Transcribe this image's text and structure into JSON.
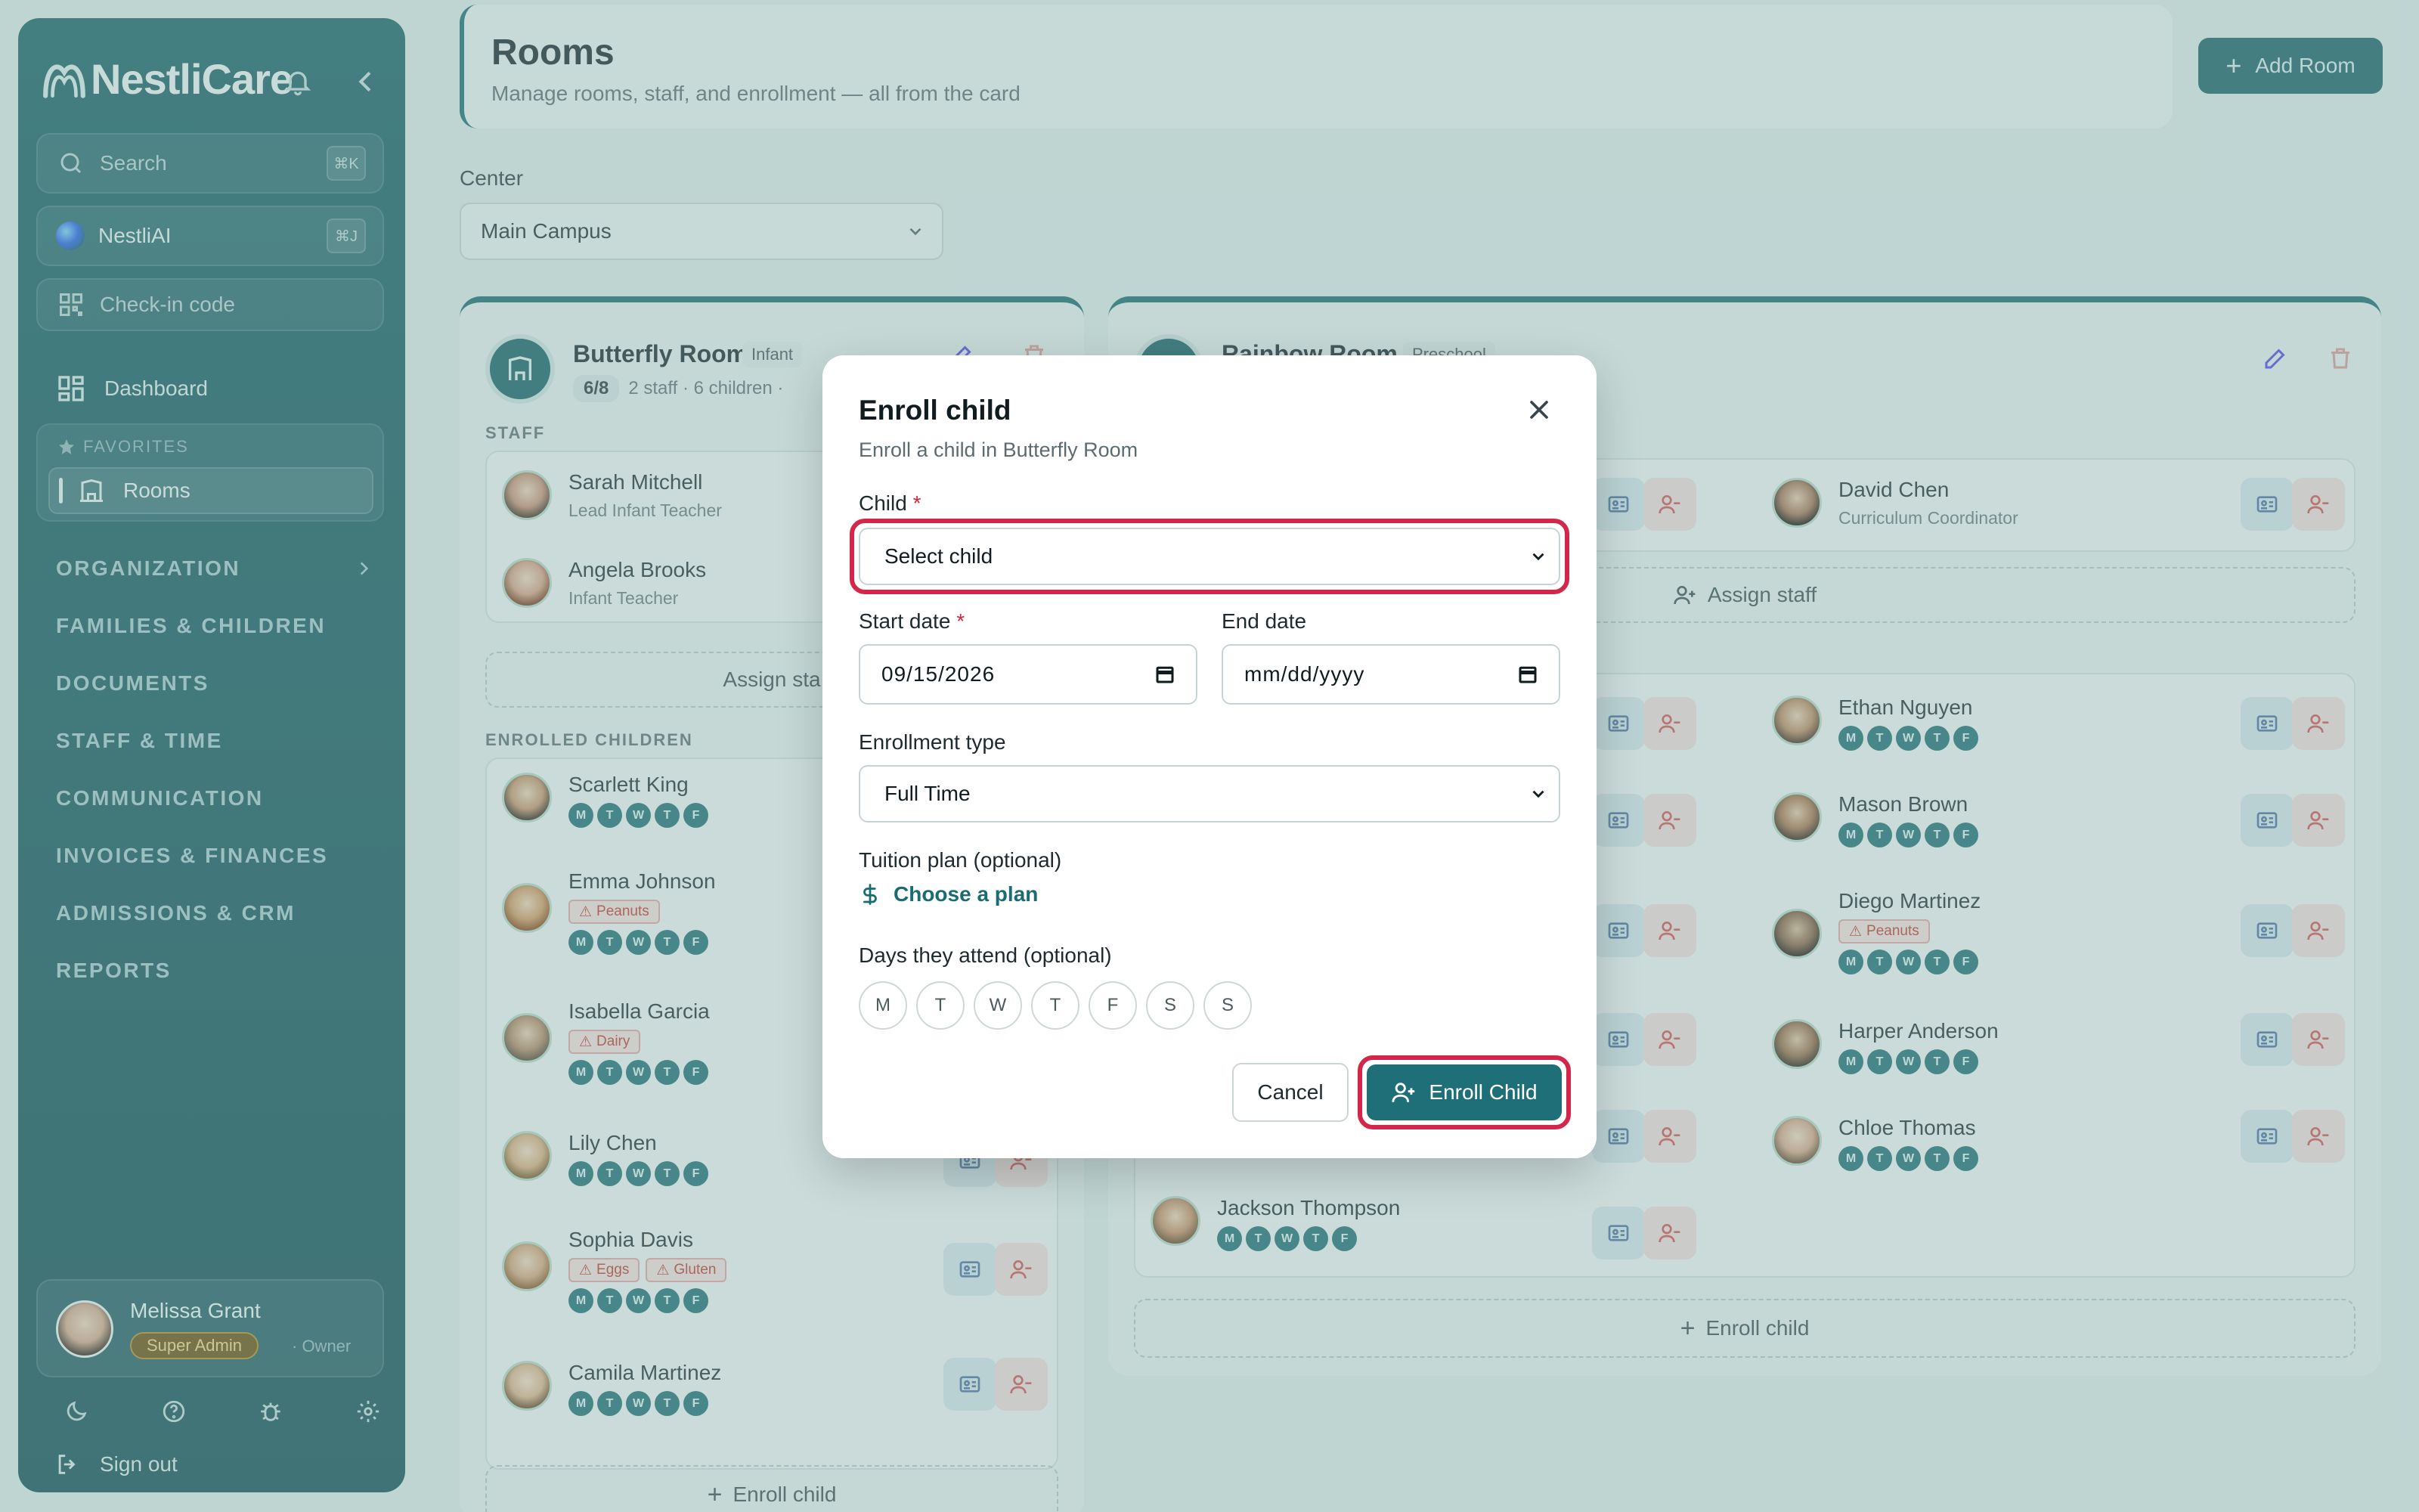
{
  "sidebar": {
    "brand": "NestliCare",
    "search_placeholder": "Search",
    "search_shortcut": "⌘K",
    "ai_label": "NestliAI",
    "ai_shortcut": "⌘J",
    "checkin_label": "Check-in code",
    "dashboard_label": "Dashboard",
    "favorites_label": "FAVORITES",
    "favorite_item": "Rooms",
    "nav": [
      "ORGANIZATION",
      "FAMILIES & CHILDREN",
      "DOCUMENTS",
      "STAFF & TIME",
      "COMMUNICATION",
      "INVOICES & FINANCES",
      "ADMISSIONS & CRM",
      "REPORTS"
    ],
    "user": {
      "name": "Melissa Grant",
      "role": "Super Admin",
      "role_sub": "· Owner"
    },
    "signout": "Sign out"
  },
  "header": {
    "title": "Rooms",
    "subtitle": "Manage rooms, staff, and enrollment — all from the card",
    "add_room": "Add Room"
  },
  "center": {
    "label": "Center",
    "value": "Main Campus"
  },
  "rooms": {
    "left": {
      "name": "Butterfly Room",
      "type": "Infant",
      "capacity": "6/8",
      "meta": "2 staff · 6 children ·",
      "staff_label": "STAFF",
      "staff": [
        {
          "name": "Sarah Mitchell",
          "role": "Lead Infant Teacher"
        },
        {
          "name": "Angela Brooks",
          "role": "Infant Teacher"
        }
      ],
      "assign_staff": "Assign sta",
      "children_label": "ENROLLED CHILDREN",
      "children": [
        {
          "name": "Scarlett King",
          "allergies": []
        },
        {
          "name": "Emma Johnson",
          "allergies": [
            "Peanuts"
          ]
        },
        {
          "name": "Isabella Garcia",
          "allergies": [
            "Dairy"
          ]
        },
        {
          "name": "Lily Chen",
          "allergies": []
        },
        {
          "name": "Sophia Davis",
          "allergies": [
            "Eggs",
            "Gluten"
          ]
        },
        {
          "name": "Camila Martinez",
          "allergies": []
        }
      ],
      "enroll_child": "Enroll child"
    },
    "right": {
      "name": "Rainbow Room",
      "type": "Preschool",
      "staff_right": {
        "name": "David Chen",
        "role": "Curriculum Coordinator"
      },
      "assign_staff": "Assign staff",
      "children_right": [
        {
          "name": "Ethan Nguyen",
          "allergies": []
        },
        {
          "name": "Mason Brown",
          "allergies": []
        },
        {
          "name": "Diego Martinez",
          "allergies": [
            "Peanuts"
          ]
        },
        {
          "name": "Harper Anderson",
          "allergies": []
        },
        {
          "name": "Chloe Thomas",
          "allergies": []
        }
      ],
      "child_left_bottom": {
        "name": "Jackson Thompson"
      },
      "enroll_child": "Enroll child"
    },
    "day_letters": [
      "M",
      "T",
      "W",
      "T",
      "F"
    ]
  },
  "modal": {
    "title": "Enroll child",
    "subtitle": "Enroll a child in Butterfly Room",
    "child_label": "Child",
    "required_mark": "*",
    "child_value": "Select child",
    "start_label": "Start date",
    "start_value": "09/15/2026",
    "end_label": "End date",
    "end_value": "mm/dd/yyyy",
    "type_label": "Enrollment type",
    "type_value": "Full Time",
    "plan_label": "Tuition plan (optional)",
    "plan_link": "Choose a plan",
    "days_label": "Days they attend (optional)",
    "days": [
      "M",
      "T",
      "W",
      "T",
      "F",
      "S",
      "S"
    ],
    "cancel": "Cancel",
    "submit": "Enroll Child"
  },
  "colors": {
    "accent": "#1f6f78",
    "focus": "#d4264a",
    "sidebar": "#175f66"
  }
}
